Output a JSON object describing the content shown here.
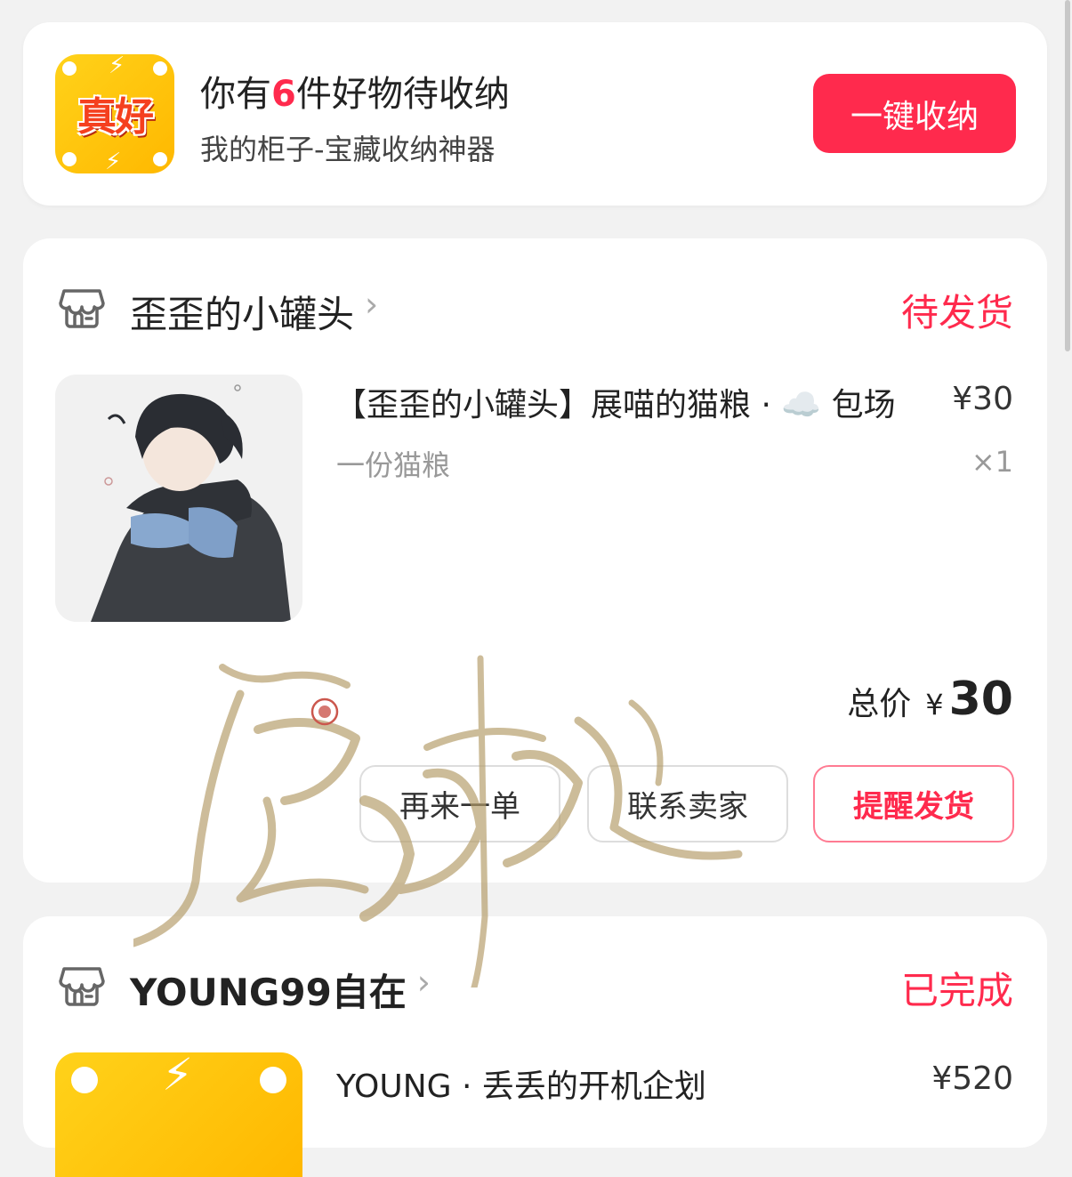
{
  "banner": {
    "icon_text": "真好",
    "title_prefix": "你有",
    "title_count": "6",
    "title_suffix": "件好物待收纳",
    "subtitle": "我的柜子-宝藏收纳神器",
    "button_label": "一键收纳"
  },
  "orders": [
    {
      "shop_name": "歪歪的小罐头",
      "status": "待发货",
      "product_title": "【歪歪的小罐头】展喵的猫粮 · ☁️ 包场",
      "price": "¥30",
      "spec": "一份猫粮",
      "quantity": "×1",
      "total_label": "总价",
      "total_currency": "¥",
      "total_value": "30",
      "buttons": [
        "再来一单",
        "联系卖家",
        "提醒发货"
      ]
    },
    {
      "shop_name": "YOUNG99自在",
      "status": "已完成",
      "product_title": "YOUNG · 丢丢的开机企划",
      "price": "¥520"
    }
  ],
  "watermark_text": "鹿鸣",
  "colors": {
    "accent": "#ff2a4d",
    "background": "#f2f2f2",
    "card": "#ffffff"
  }
}
